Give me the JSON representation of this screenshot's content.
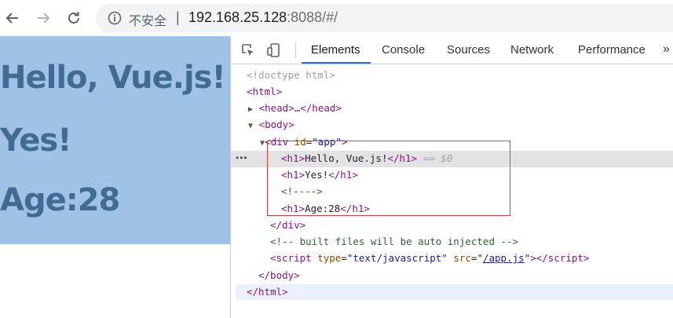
{
  "browser": {
    "security_text": "不安全",
    "separator": "|",
    "url_host": "192.168.25.128",
    "url_port_path": ":8088/#/"
  },
  "page": {
    "headings": [
      "Hello, Vue.js!",
      "Yes!",
      "Age:28"
    ]
  },
  "devtools": {
    "tabs": [
      "Elements",
      "Console",
      "Sources",
      "Network",
      "Performance"
    ],
    "more_label": "»",
    "selected_suffix": "== $0",
    "dots": "•••",
    "lines": {
      "doctype": "<!doctype html>",
      "html_open": "<html>",
      "head": "<head>…</head>",
      "body_open": "<body>",
      "div_tag": "div",
      "div_attr": "id",
      "div_val": "\"app\"",
      "h1_1_text": "Hello, Vue.js!",
      "h1_2_text": "Yes!",
      "comment_empty": "<!---->",
      "h1_3_text": "Age:28",
      "div_close": "</div>",
      "comment_built": "<!-- built files will be auto injected -->",
      "script_type_val": "\"text/javascript\"",
      "script_src_val": "/app.js",
      "body_close": "</body>",
      "html_close": "</html>"
    }
  }
}
